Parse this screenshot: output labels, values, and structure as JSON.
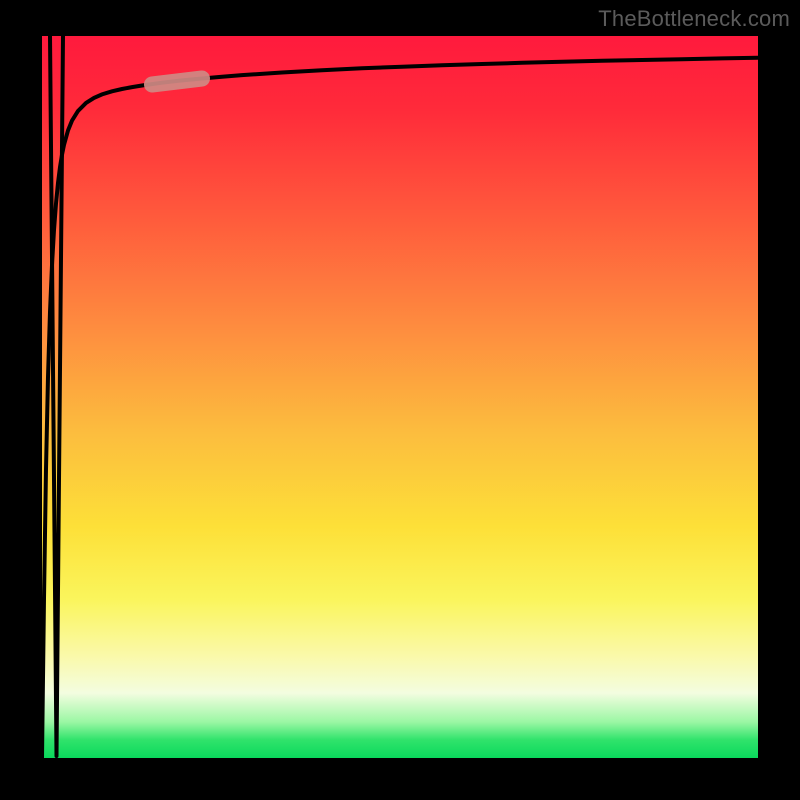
{
  "attribution": "TheBottleneck.com",
  "colors": {
    "frame": "#000000",
    "curve": "#000000",
    "highlight": "#cf8a84",
    "gradient_top": "#ff1a3d",
    "gradient_mid1": "#ff5a3c",
    "gradient_mid2": "#fcbd3e",
    "gradient_mid3": "#fde038",
    "gradient_bottom": "#0ad85c"
  },
  "chart_data": {
    "type": "line",
    "title": "",
    "xlabel": "",
    "ylabel": "",
    "xlim": [
      0,
      100
    ],
    "ylim": [
      0,
      100
    ],
    "legend": false,
    "grid": false,
    "series": [
      {
        "name": "bottleneck-curve",
        "x": [
          0.0,
          0.28,
          0.56,
          0.84,
          1.12,
          1.4,
          1.68,
          1.96,
          2.23,
          2.51,
          2.79,
          3.07,
          3.63,
          4.19,
          5.03,
          6.15,
          7.26,
          8.38,
          9.78,
          11.17,
          12.57,
          13.97,
          16.76,
          19.55,
          22.35,
          25.14,
          27.93,
          33.52,
          39.11,
          44.69,
          50.28,
          55.87,
          61.45,
          67.04,
          72.63,
          78.21,
          83.8,
          89.39,
          94.97,
          100.0
        ],
        "y": [
          0.0,
          22.16,
          40.03,
          52.77,
          61.77,
          68.28,
          73.13,
          76.8,
          79.64,
          81.83,
          83.56,
          84.93,
          86.91,
          88.28,
          89.61,
          90.72,
          91.43,
          91.91,
          92.34,
          92.66,
          92.92,
          93.15,
          93.53,
          93.85,
          94.12,
          94.36,
          94.58,
          94.95,
          95.26,
          95.52,
          95.75,
          95.95,
          96.13,
          96.29,
          96.43,
          96.56,
          96.68,
          96.79,
          96.9,
          96.99
        ]
      }
    ],
    "highlight_segment": {
      "series": "bottleneck-curve",
      "x_start": 15.4,
      "x_end": 22.3,
      "note": "pink rounded marker on curve"
    },
    "background_heatmap": {
      "axis": "y",
      "stops": [
        {
          "y": 100,
          "color": "#ff1a3d"
        },
        {
          "y": 75,
          "color": "#ff5a3c"
        },
        {
          "y": 55,
          "color": "#fcbd3e"
        },
        {
          "y": 35,
          "color": "#fde038"
        },
        {
          "y": 12,
          "color": "#faf9ab"
        },
        {
          "y": 0,
          "color": "#0ad85c"
        }
      ]
    }
  }
}
